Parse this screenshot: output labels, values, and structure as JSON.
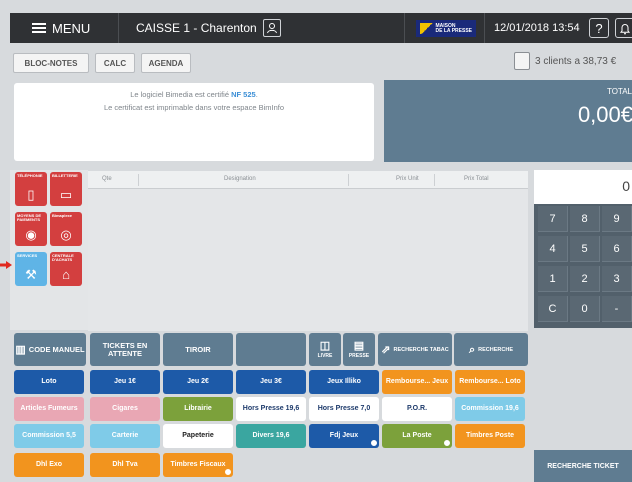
{
  "header": {
    "menu_label": "MENU",
    "register_label": "CAISSE 1 - Charenton",
    "brand_line1": "MAISON",
    "brand_line2": "DE LA PRESSE",
    "datetime": "12/01/2018 13:54",
    "help_symbol": "?",
    "icons": [
      "menu-icon",
      "user-icon",
      "help-icon",
      "bell-icon"
    ]
  },
  "toolbar": {
    "notes_label": "BLOC-NOTES",
    "calc_label": "CALC",
    "agenda_label": "AGENDA",
    "clients_summary": "3 clients a 38,73 €"
  },
  "info": {
    "line1_prefix": "Le logiciel Bimedia est certifié ",
    "line1_highlight": "NF 525",
    "line1_suffix": ".",
    "line2": "Le certificat est imprimable dans votre espace BimInfo"
  },
  "total": {
    "label": "TOTAL",
    "amount": "0,00€"
  },
  "quick_buttons": [
    {
      "label": "TÉLÉPHONIE",
      "icon": "phone-icon",
      "glyph": "▯",
      "color": "#d33f3f"
    },
    {
      "label": "BILLETTERIE",
      "icon": "ticket-icon",
      "glyph": "▭",
      "color": "#d33f3f"
    },
    {
      "label": "MOYENS DE PAIEMENTS",
      "icon": "payment-icon",
      "glyph": "◉",
      "color": "#d33f3f"
    },
    {
      "label": "Bimaplexe",
      "icon": "swirl-icon",
      "glyph": "◎",
      "color": "#d33f3f"
    },
    {
      "label": "SERVICES",
      "icon": "services-icon",
      "glyph": "⚒",
      "color": "#5fb4e6"
    },
    {
      "label": "CENTRALE D'ACHATS",
      "icon": "basket-icon",
      "glyph": "⌂",
      "color": "#d33f3f"
    }
  ],
  "ticket_table": {
    "columns": [
      "Qte",
      "Designation",
      "Prix Unit",
      "Prix Total"
    ]
  },
  "keypad": {
    "display": "0",
    "keys": [
      "7",
      "8",
      "9",
      "4",
      "5",
      "6",
      "1",
      "2",
      "3",
      "C",
      "0",
      "-"
    ]
  },
  "nav_buttons": {
    "code_manuel": "CODE MANUEL",
    "tickets_attente": "TICKETS EN ATTENTE",
    "tiroir": "TIROIR",
    "livre": "LIVRE",
    "presse": "PRESSE",
    "recherche_tabac": "RECHERCHE TABAC",
    "recherche": "RECHERCHE"
  },
  "product_buttons": [
    {
      "label": "Loto",
      "color": "#1d5aa8"
    },
    {
      "label": "Jeu 1€",
      "color": "#1d5aa8"
    },
    {
      "label": "Jeu 2€",
      "color": "#1d5aa8"
    },
    {
      "label": "Jeu 3€",
      "color": "#1d5aa8"
    },
    {
      "label": "Jeux Illiko",
      "color": "#1d5aa8"
    },
    {
      "label": "Rembourse... Jeux",
      "color": "#f2941e"
    },
    {
      "label": "Rembourse... Loto",
      "color": "#f2941e"
    },
    {
      "label": "Articles Fumeurs",
      "color": "#e9a7b4"
    },
    {
      "label": "Cigares",
      "color": "#e9a7b4"
    },
    {
      "label": "Librairie",
      "color": "#7ca13b"
    },
    {
      "label": "Hors Presse 19,6",
      "color": "#ffffff",
      "text_color": "#1d3a6b"
    },
    {
      "label": "Hors Presse 7,0",
      "color": "#ffffff",
      "text_color": "#1d3a6b"
    },
    {
      "label": "P.O.R.",
      "color": "#ffffff",
      "text_color": "#1d3a6b"
    },
    {
      "label": "Commission 19,6",
      "color": "#7fcbe8"
    },
    {
      "label": "Commission 5,5",
      "color": "#7fcbe8"
    },
    {
      "label": "Carterie",
      "color": "#7fcbe8"
    },
    {
      "label": "Papeterie",
      "color": "#ffffff",
      "text_color": "#222222"
    },
    {
      "label": "Divers 19,6",
      "color": "#3aa6a0"
    },
    {
      "label": "Fdj Jeux",
      "color": "#1d5aa8"
    },
    {
      "label": "La Poste",
      "color": "#7ca13b"
    },
    {
      "label": "Timbres Poste",
      "color": "#f2941e"
    },
    {
      "label": "Dhl Exo",
      "color": "#f2941e"
    },
    {
      "label": "Dhl Tva",
      "color": "#f2941e"
    },
    {
      "label": "Timbres Fiscaux",
      "color": "#f2941e"
    }
  ],
  "search_ticket_label": "RECHERCHE TICKET"
}
